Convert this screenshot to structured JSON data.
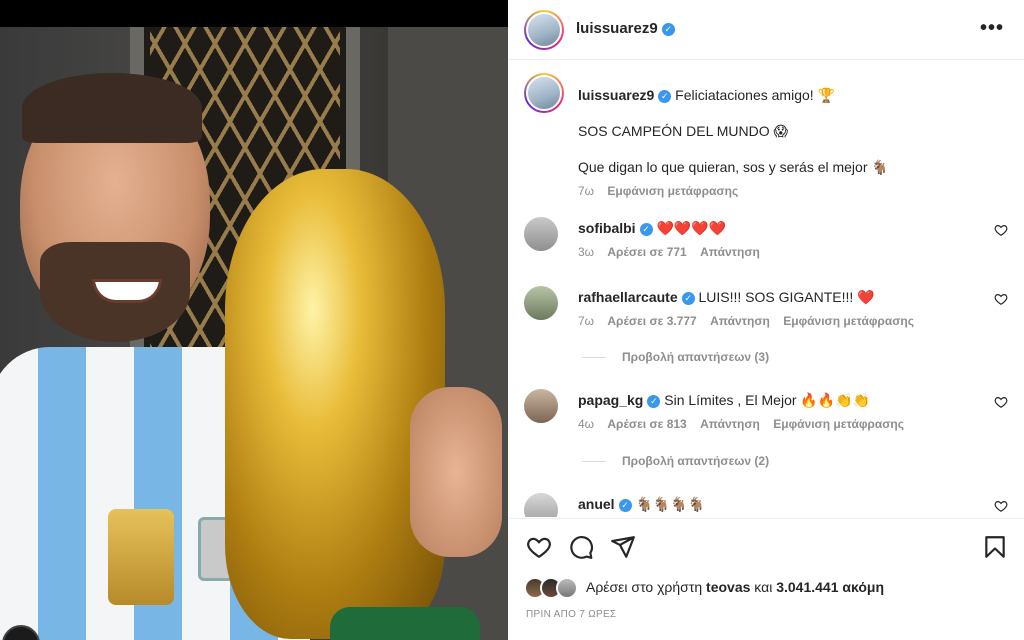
{
  "header": {
    "username": "luissuarez9",
    "more_label": "•••"
  },
  "caption": {
    "username": "luissuarez9",
    "line1": "Feliciataciones amigo! 🏆",
    "line2": "SOS CAMPEÓN DEL MUNDO 😱",
    "line3": "Que digan lo que quieran, sos y serás el mejor 🐐",
    "time": "7ω",
    "translate": "Εμφάνιση μετάφρασης"
  },
  "comments": [
    {
      "username": "sofibalbi",
      "text": "❤️❤️❤️❤️",
      "time": "3ω",
      "likes": "Αρέσει σε 771",
      "reply": "Απάντηση",
      "translate": ""
    },
    {
      "username": "rafhaellarcaute",
      "text": "LUIS!!! SOS GIGANTE!!! ❤️",
      "time": "7ω",
      "likes": "Αρέσει σε 3.777",
      "reply": "Απάντηση",
      "translate": "Εμφάνιση μετάφρασης",
      "view_replies": "Προβολή απαντήσεων (3)"
    },
    {
      "username": "papag_kg",
      "text": "Sin Límites , El Mejor 🔥🔥👏👏",
      "time": "4ω",
      "likes": "Αρέσει σε 813",
      "reply": "Απάντηση",
      "translate": "Εμφάνιση μετάφρασης",
      "view_replies": "Προβολή απαντήσεων (2)"
    },
    {
      "username": "anuel",
      "text": "🐐🐐🐐🐐",
      "time": "",
      "likes": "",
      "reply": "",
      "translate": ""
    }
  ],
  "likes": {
    "prefix": "Αρέσει στο χρήστη",
    "user": "teovas",
    "conj": "και",
    "count": "3.041.441 ακόμη"
  },
  "timestamp": "ΠΡΙΝ ΑΠΟ 7 ΩΡΕΣ",
  "icons": {
    "like": "heart-icon",
    "comment": "comment-icon",
    "share": "send-icon",
    "save": "bookmark-icon"
  },
  "colors": {
    "verified": "#3897f0",
    "muted": "#8e8e8e",
    "text": "#262626"
  }
}
